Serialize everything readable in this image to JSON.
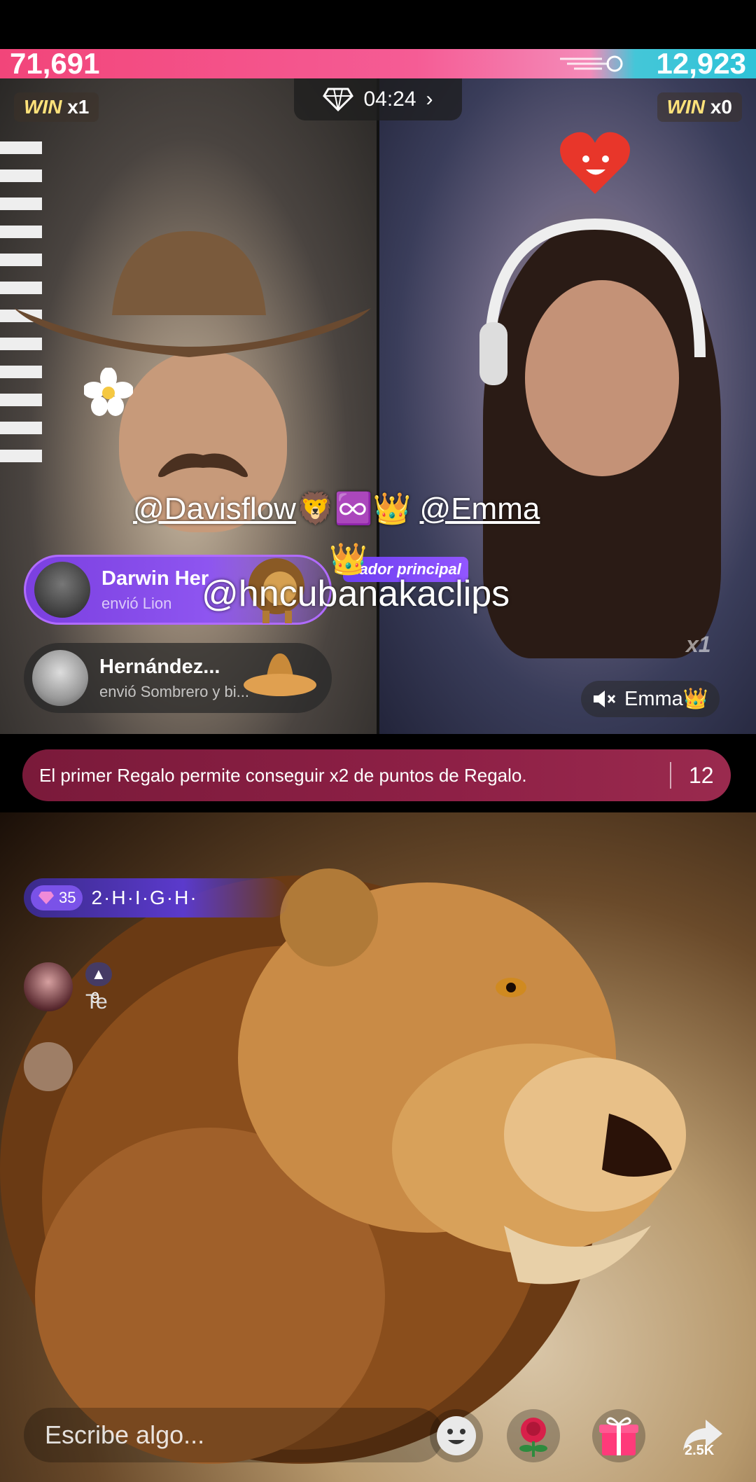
{
  "battle": {
    "score_left": "71,691",
    "score_right": "12,923",
    "timer": "04:24",
    "win_left": {
      "label": "WIN",
      "count": "x1"
    },
    "win_right": {
      "label": "WIN",
      "count": "x0"
    }
  },
  "mentions": {
    "line1_user": "@Davisflow",
    "line1_emojis": "🦁♾️👑",
    "line1_user2": "@Emma",
    "line2": "@hncubanakaclips"
  },
  "gifts": [
    {
      "name": "Darwin Her",
      "action": "envió Lion"
    },
    {
      "name": "Hernández...",
      "action": "envió Sombrero y bi..."
    }
  ],
  "role_tag": "nador principal",
  "crown_emoji": "👑",
  "guest": {
    "name": "Emma👑",
    "multiplier": "x1"
  },
  "banner": {
    "text": "El primer Regalo permite conseguir x2 de puntos de Regalo.",
    "countdown": "12 s"
  },
  "chat": {
    "top_level": "35",
    "top_message": "2·H·I·G·H·",
    "row_level": "9",
    "row_text": "Te"
  },
  "bottom": {
    "input_placeholder": "Escribe algo...",
    "share_count": "2.5K"
  },
  "colors": {
    "score_pink": "#f2457a",
    "score_cyan": "#2ec3d8",
    "banner": "#8e2046",
    "gift_purple": "#8e55f0"
  }
}
